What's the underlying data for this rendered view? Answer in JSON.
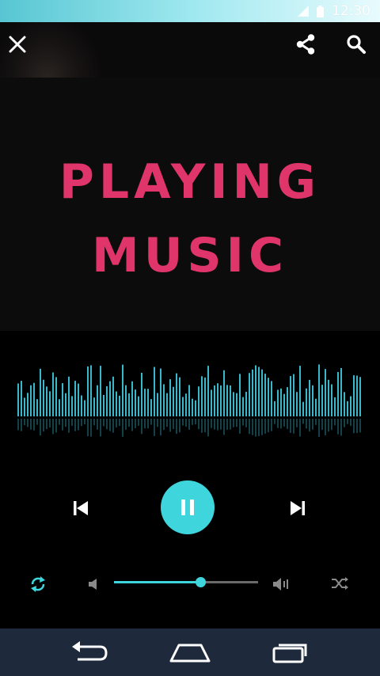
{
  "status_bar": {
    "time": "12:30",
    "icons": [
      "signal-icon",
      "battery-icon"
    ]
  },
  "toolbar": {
    "icons": [
      "close-icon",
      "share-icon",
      "search-icon"
    ]
  },
  "hero": {
    "line1": "PLAYING",
    "line2": "MUSIC"
  },
  "player": {
    "state": "playing",
    "volume_level": 0.6,
    "icons": [
      "previous-icon",
      "pause-icon",
      "next-icon",
      "repeat-icon",
      "volume-down-icon",
      "volume-up-icon",
      "shuffle-icon"
    ]
  },
  "nav_bar": {
    "icons": [
      "back-icon",
      "home-icon",
      "recents-icon"
    ]
  },
  "colors": {
    "accent": "#3ed6dc",
    "headline": "#e0356a",
    "nav_bg": "#1e2a3c",
    "eq": "#38b8cc"
  }
}
